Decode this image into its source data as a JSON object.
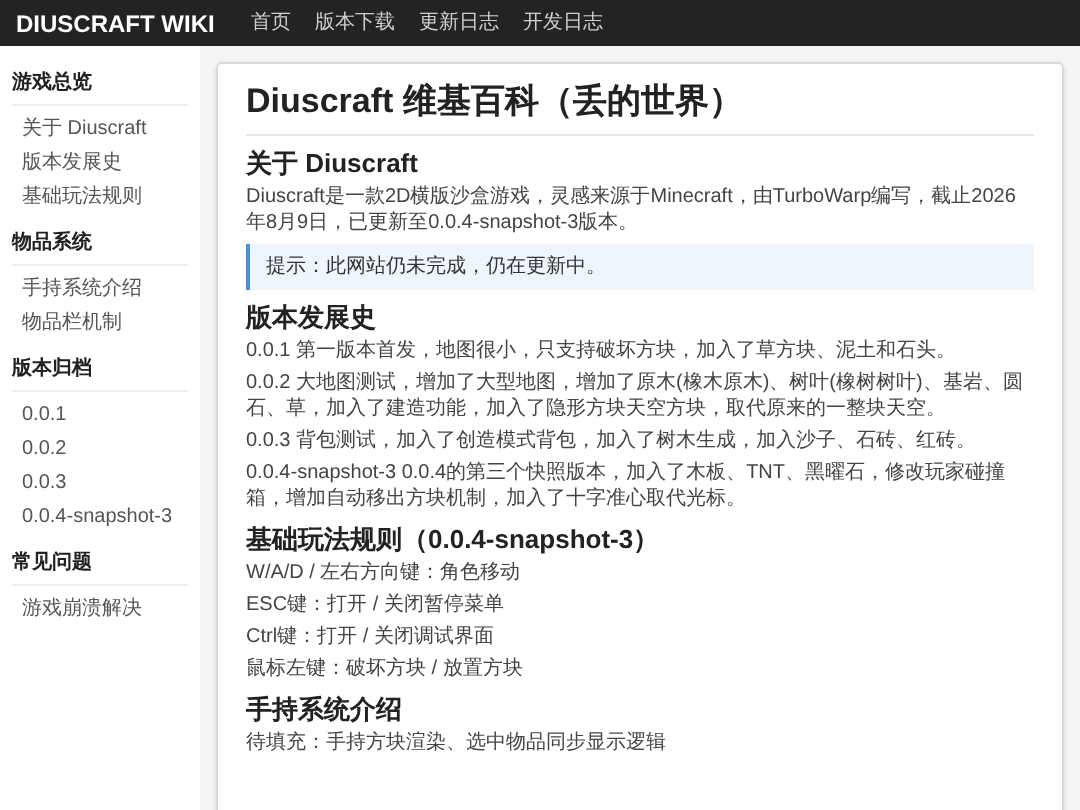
{
  "header": {
    "brand": "DIUSCRAFT WIKI",
    "nav": [
      "首页",
      "版本下载",
      "更新日志",
      "开发日志"
    ]
  },
  "sidebar": {
    "sections": [
      {
        "title": "游戏总览",
        "items": [
          "关于 Diuscraft",
          "版本发展史",
          "基础玩法规则"
        ]
      },
      {
        "title": "物品系统",
        "items": [
          "手持系统介绍",
          "物品栏机制"
        ]
      },
      {
        "title": "版本归档",
        "items": [
          "0.0.1",
          "0.0.2",
          "0.0.3",
          "0.0.4-snapshot-3"
        ]
      },
      {
        "title": "常见问题",
        "items": [
          "游戏崩溃解决"
        ]
      }
    ]
  },
  "article": {
    "title": "Diuscraft 维基百科（丢的世界）",
    "sections": [
      {
        "heading": "关于 Diuscraft",
        "paragraphs": [
          "Diuscraft是一款2D横版沙盒游戏，灵感来源于Minecraft，由TurboWarp编写，截止2026年8月9日，已更新至0.0.4-snapshot-3版本。"
        ],
        "note": "提示：此网站仍未完成，仍在更新中。"
      },
      {
        "heading": "版本发展史",
        "paragraphs": [
          "0.0.1 第一版本首发，地图很小，只支持破坏方块，加入了草方块、泥土和石头。",
          "0.0.2 大地图测试，增加了大型地图，增加了原木(橡木原木)、树叶(橡树树叶)、基岩、圆石、草，加入了建造功能，加入了隐形方块天空方块，取代原来的一整块天空。",
          "0.0.3 背包测试，加入了创造模式背包，加入了树木生成，加入沙子、石砖、红砖。",
          "0.0.4-snapshot-3 0.0.4的第三个快照版本，加入了木板、TNT、黑曜石，修改玩家碰撞箱，增加自动移出方块机制，加入了十字准心取代光标。"
        ]
      },
      {
        "heading": "基础玩法规则（0.0.4-snapshot-3）",
        "paragraphs": [
          "W/A/D / 左右方向键：角色移动",
          "ESC键：打开 / 关闭暂停菜单",
          "Ctrl键：打开 / 关闭调试界面",
          "鼠标左键：破坏方块 / 放置方块"
        ]
      },
      {
        "heading": "手持系统介绍",
        "paragraphs": [
          "待填充：手持方块渲染、选中物品同步显示逻辑"
        ]
      }
    ]
  }
}
